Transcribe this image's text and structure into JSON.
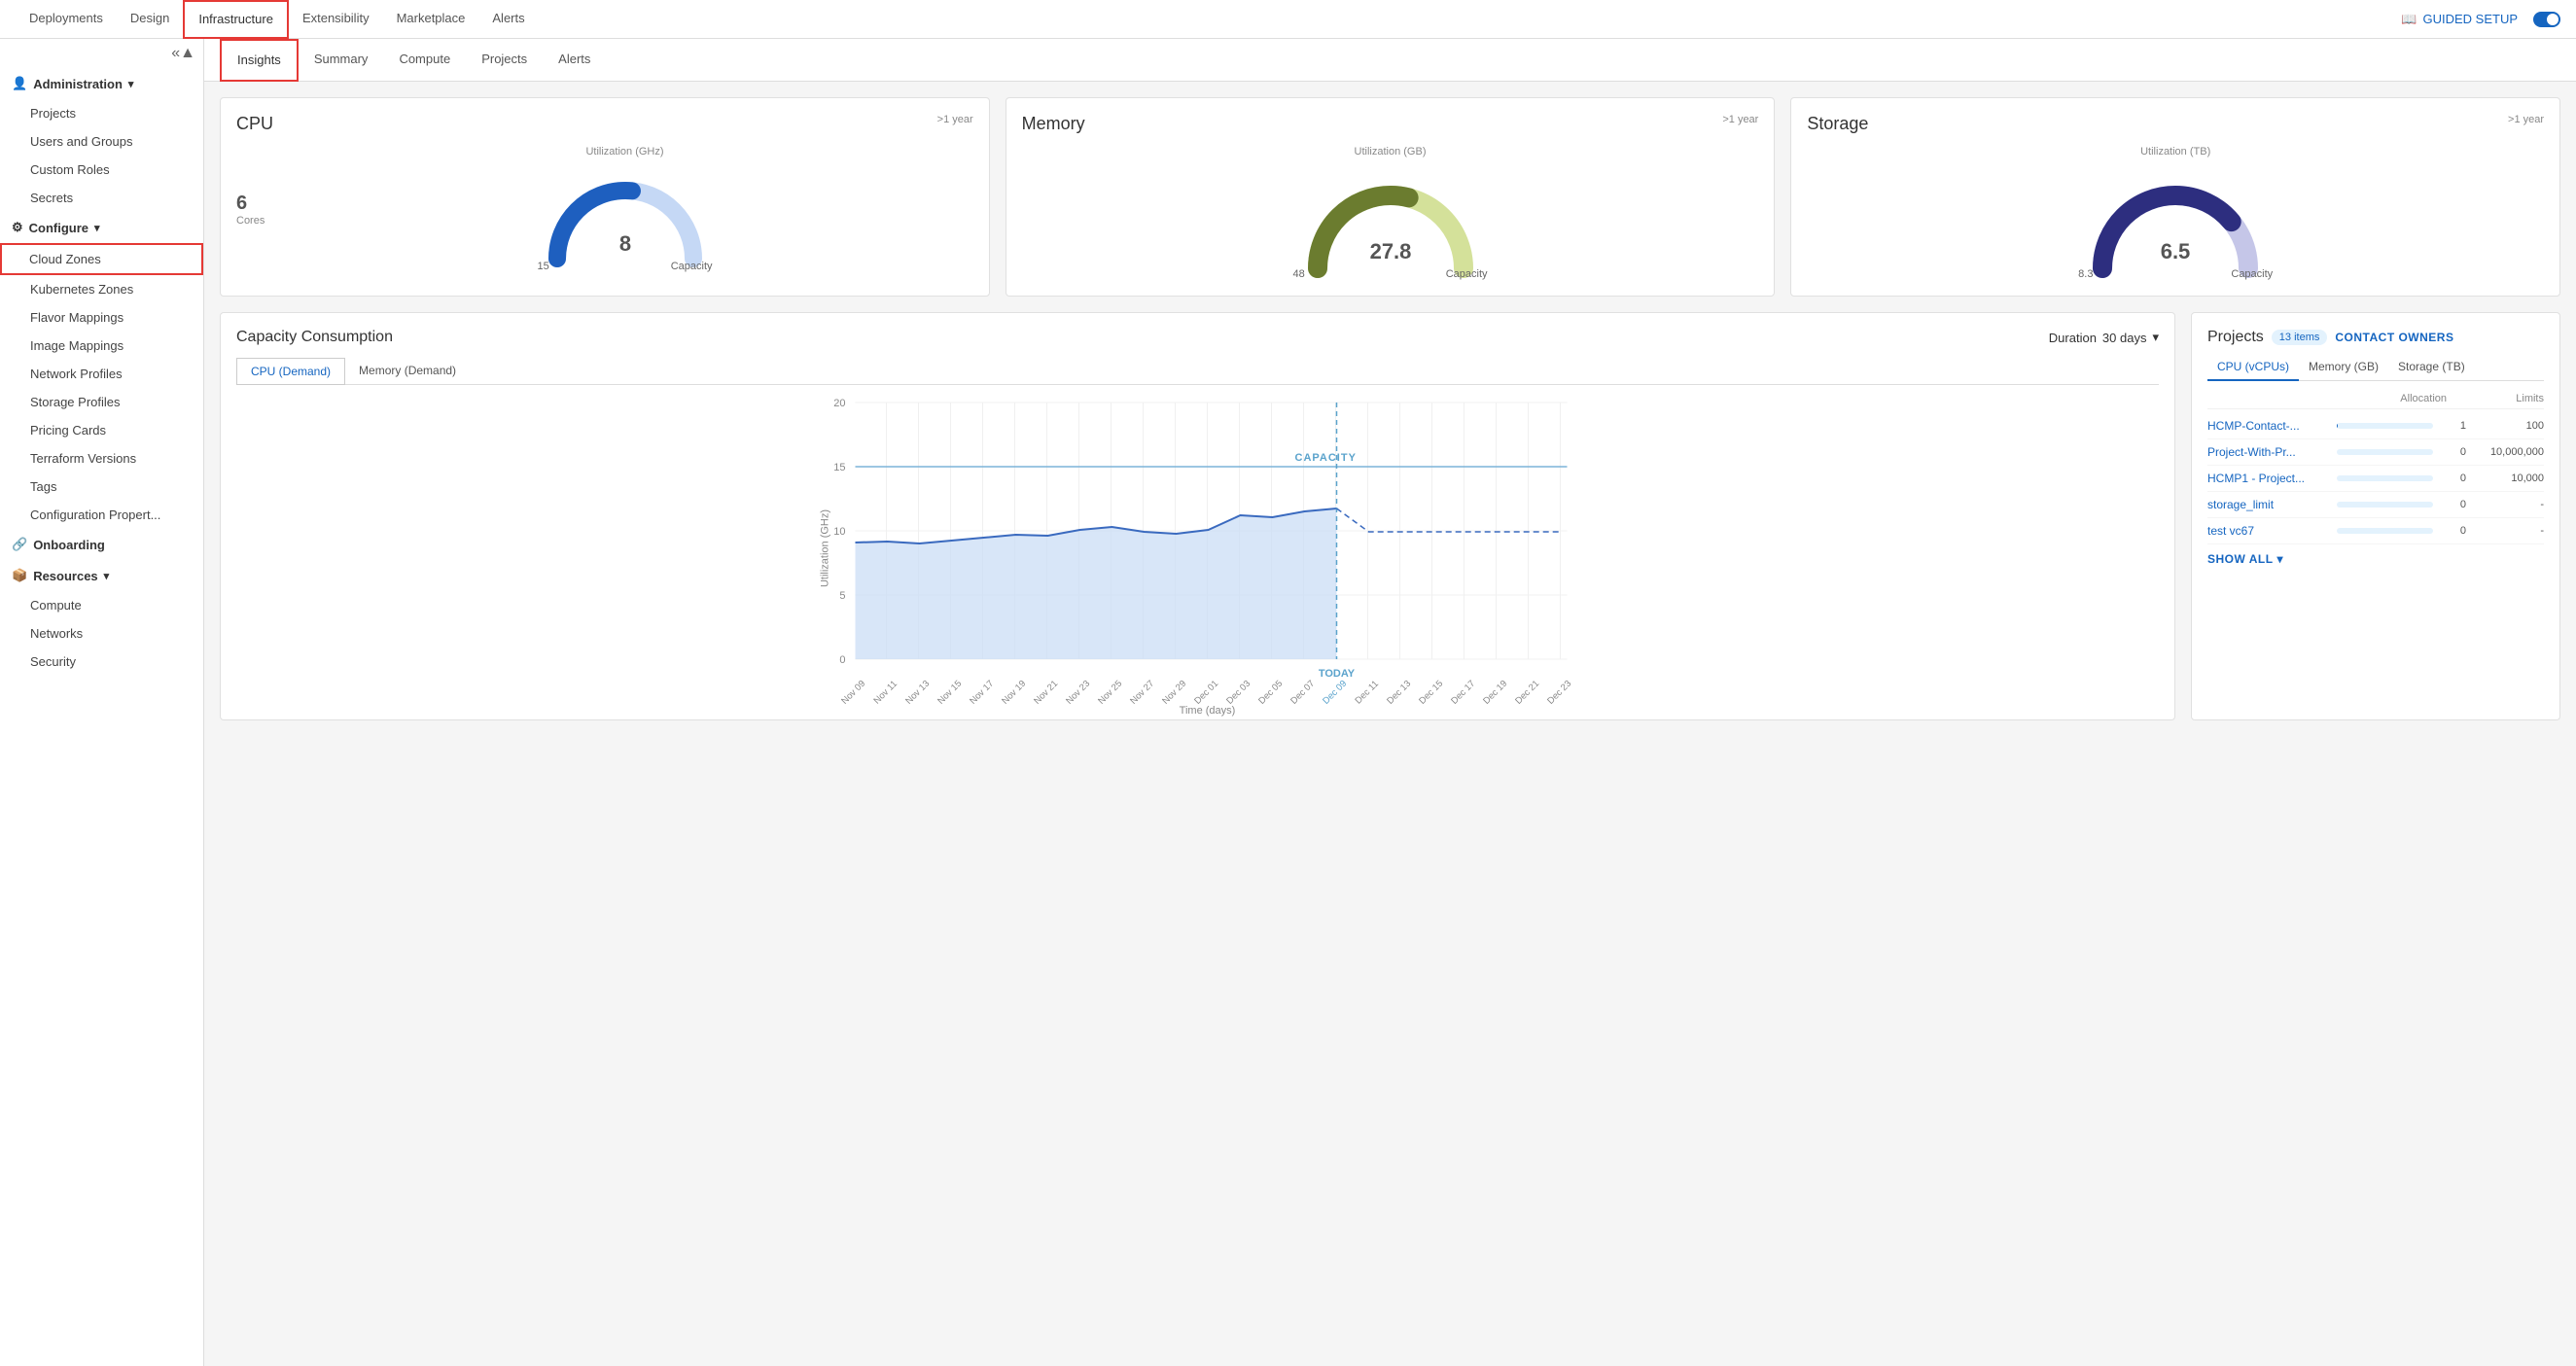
{
  "topNav": {
    "items": [
      {
        "label": "Deployments",
        "active": false
      },
      {
        "label": "Design",
        "active": false
      },
      {
        "label": "Infrastructure",
        "active": true,
        "highlighted": true
      },
      {
        "label": "Extensibility",
        "active": false
      },
      {
        "label": "Marketplace",
        "active": false
      },
      {
        "label": "Alerts",
        "active": false
      }
    ],
    "guidedSetup": "GUIDED SETUP"
  },
  "sidebar": {
    "collapseIcon": "«",
    "upIcon": "▲",
    "groups": [
      {
        "label": "Administration",
        "expanded": true,
        "items": [
          "Projects",
          "Users and Groups",
          "Custom Roles",
          "Secrets"
        ]
      },
      {
        "label": "Configure",
        "expanded": true,
        "items": [
          "Cloud Zones",
          "Kubernetes Zones",
          "Flavor Mappings",
          "Image Mappings",
          "Network Profiles",
          "Storage Profiles",
          "Pricing Cards",
          "Terraform Versions",
          "Tags",
          "Configuration Propert..."
        ]
      },
      {
        "label": "Onboarding",
        "expanded": false,
        "items": []
      },
      {
        "label": "Resources",
        "expanded": true,
        "items": [
          "Compute",
          "Networks",
          "Security"
        ]
      }
    ],
    "activeItem": "Cloud Zones"
  },
  "subTabs": {
    "items": [
      {
        "label": "Insights",
        "active": true,
        "highlighted": true
      },
      {
        "label": "Summary",
        "active": false
      },
      {
        "label": "Compute",
        "active": false
      },
      {
        "label": "Projects",
        "active": false
      },
      {
        "label": "Alerts",
        "active": false
      }
    ]
  },
  "gauges": [
    {
      "title": "CPU",
      "period": ">1 year",
      "metricLabel": "Utilization (GHz)",
      "sideLabel": "6",
      "sideSublabel": "Cores",
      "centerValue": "8",
      "bottomLeft": "15",
      "bottomLeftLabel": "Capacity",
      "color": "#1e5fbf",
      "bgColor": "#c5d8f5",
      "pct": 0.53
    },
    {
      "title": "Memory",
      "period": ">1 year",
      "metricLabel": "Utilization (GB)",
      "sideLabel": "",
      "sideSublabel": "",
      "centerValue": "27.8",
      "bottomLeft": "48",
      "bottomLeftLabel": "Capacity",
      "color": "#6b7c2f",
      "bgColor": "#d4e19a",
      "pct": 0.58
    },
    {
      "title": "Storage",
      "period": ">1 year",
      "metricLabel": "Utilization (TB)",
      "sideLabel": "",
      "sideSublabel": "",
      "centerValue": "6.5",
      "bottomLeft": "8.3",
      "bottomLeftLabel": "Capacity",
      "color": "#2d2e7f",
      "bgColor": "#c5c6e8",
      "pct": 0.78
    }
  ],
  "capacityChart": {
    "title": "Capacity Consumption",
    "durationLabel": "Duration",
    "duration": "30 days",
    "tabs": [
      {
        "label": "CPU (Demand)",
        "active": true
      },
      {
        "label": "Memory (Demand)",
        "active": false
      }
    ],
    "yAxisLabel": "Utilization (GHz)",
    "xAxisLabel": "Time (days)",
    "capacityLineLabel": "CAPACITY",
    "todayLabel": "TODAY",
    "yMax": 20,
    "yValues": [
      0,
      5,
      10,
      15,
      20
    ],
    "xLabels": [
      "Nov 09",
      "Nov 11",
      "Nov 13",
      "Nov 15",
      "Nov 17",
      "Nov 19",
      "Nov 21",
      "Nov 23",
      "Nov 25",
      "Nov 27",
      "Nov 29",
      "Dec 01",
      "Dec 03",
      "Dec 05",
      "Dec 07",
      "Dec 09",
      "Dec 11",
      "Dec 13",
      "Dec 15",
      "Dec 17",
      "Dec 19",
      "Dec 21",
      "Dec 23"
    ]
  },
  "projects": {
    "title": "Projects",
    "itemsCount": "13 items",
    "contactOwners": "CONTACT OWNERS",
    "tabs": [
      {
        "label": "CPU (vCPUs)",
        "active": true
      },
      {
        "label": "Memory (GB)",
        "active": false
      },
      {
        "label": "Storage (TB)",
        "active": false
      }
    ],
    "colHeaders": {
      "allocation": "Allocation",
      "limits": "Limits"
    },
    "rows": [
      {
        "name": "HCMP-Contact-...",
        "allocation": 1,
        "limit": "100",
        "pct": 0.01
      },
      {
        "name": "Project-With-Pr...",
        "allocation": 0,
        "limit": "10,000,000",
        "pct": 0
      },
      {
        "name": "HCMP1 - Project...",
        "allocation": 0,
        "limit": "10,000",
        "pct": 0
      },
      {
        "name": "storage_limit",
        "allocation": 0,
        "limit": "-",
        "pct": 0
      },
      {
        "name": "test vc67",
        "allocation": 0,
        "limit": "-",
        "pct": 0
      }
    ],
    "showAll": "SHOW ALL"
  }
}
